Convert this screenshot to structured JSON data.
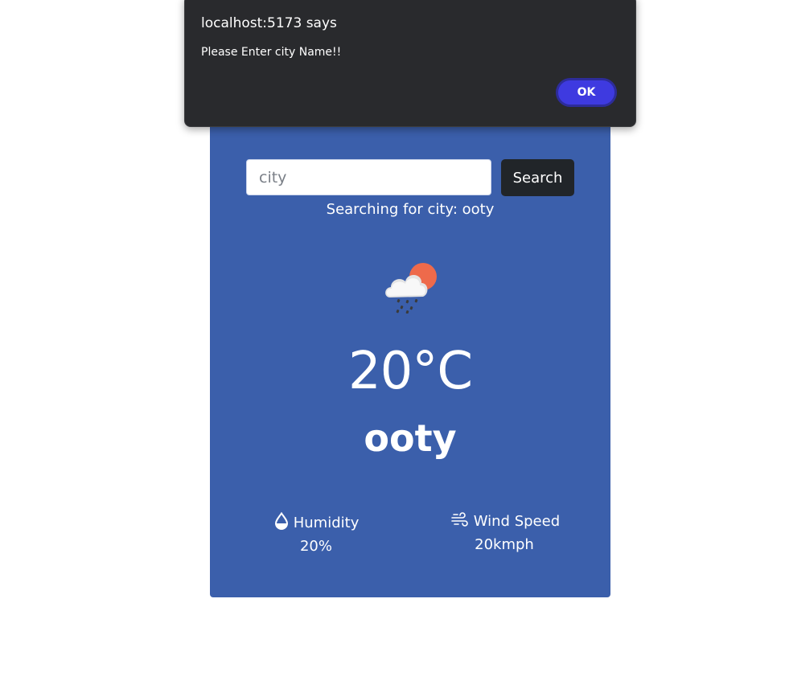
{
  "search": {
    "placeholder": "city",
    "value": "",
    "button_label": "Search",
    "status_text": "Searching for city: ooty"
  },
  "weather": {
    "icon": "cloud-rain-sun-icon",
    "temperature": "20°C",
    "city": "ooty",
    "humidity": {
      "label": "Humidity",
      "value": "20%",
      "icon": "droplet-icon"
    },
    "wind": {
      "label": "Wind Speed",
      "value": "20kmph",
      "icon": "wind-icon"
    }
  },
  "alert": {
    "title": "localhost:5173 says",
    "message": "Please Enter city Name!!",
    "ok_label": "OK"
  },
  "colors": {
    "card_background": "#3b5fab",
    "search_button": "#212529",
    "alert_background": "#292a2d",
    "alert_ok": "#3e3ae0"
  }
}
